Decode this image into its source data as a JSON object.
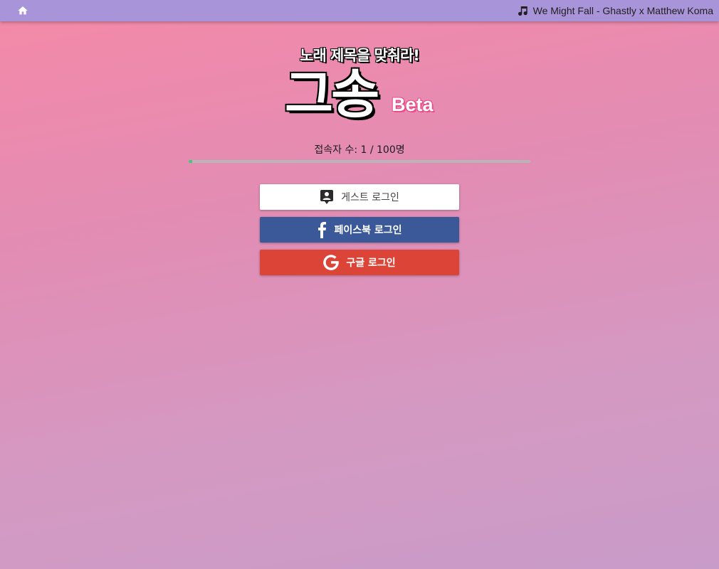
{
  "topbar": {
    "home_icon": "home-icon",
    "music_icon": "music-note-icon",
    "now_playing": "We Might Fall - Ghastly x Matthew Koma"
  },
  "header": {
    "subtitle": "노래 제목을 맞춰라!",
    "logo": "그송",
    "badge": "Beta"
  },
  "status": {
    "users_text": "접속자 수: 1 / 100명",
    "progress_fraction": 0.01
  },
  "login": {
    "guest_label": "게스트 로그인",
    "guest_icon": "contact-badge-icon",
    "facebook_label": "페이스북 로그인",
    "facebook_icon": "facebook-icon",
    "google_label": "구글 로그인",
    "google_icon": "google-icon"
  },
  "colors": {
    "topbar": "#a894d8",
    "facebook": "#3b5998",
    "google": "#db4437",
    "progress": "#3fc97b"
  }
}
